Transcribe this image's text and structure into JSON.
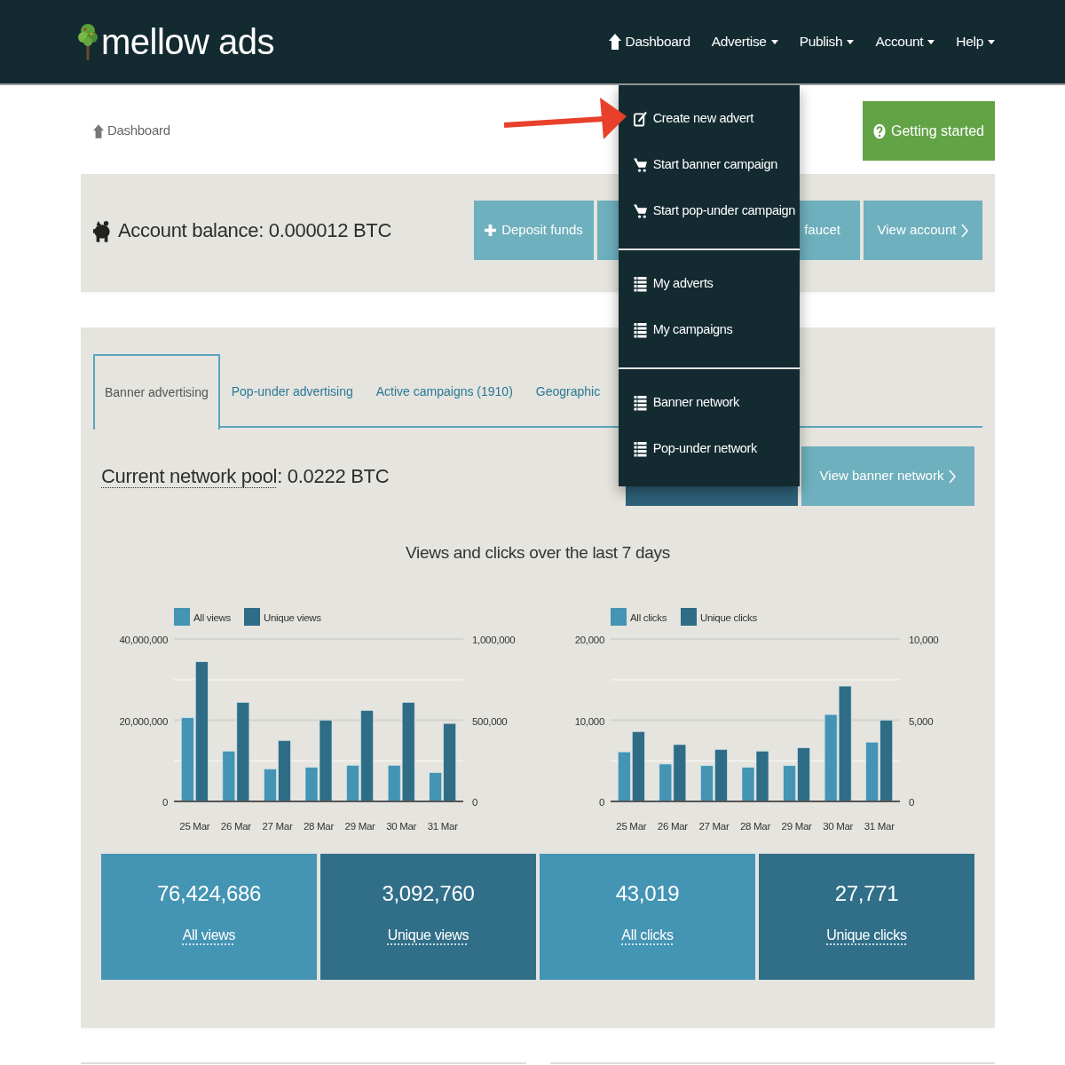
{
  "navbar": {
    "logo": "mellow ads",
    "items": [
      {
        "kind": "home",
        "label": "Dashboard"
      },
      {
        "kind": "dropdown",
        "label": "Advertise",
        "expanded": true,
        "menu": [
          [
            {
              "kind": "create",
              "label": "Create new advert"
            },
            {
              "kind": "cart",
              "label": "Start banner campaign"
            },
            {
              "kind": "cart",
              "label": "Start pop-under campaign"
            }
          ],
          [
            {
              "kind": "list",
              "label": "My adverts"
            },
            {
              "kind": "list",
              "label": "My campaigns"
            }
          ],
          [
            {
              "kind": "list",
              "label": "Banner network"
            },
            {
              "kind": "list",
              "label": "Pop-under network"
            }
          ]
        ]
      },
      {
        "kind": "dropdown",
        "label": "Publish",
        "expanded": false
      },
      {
        "kind": "dropdown",
        "label": "Account",
        "expanded": false
      },
      {
        "kind": "dropdown",
        "label": "Help",
        "expanded": false
      }
    ]
  },
  "breadcrumb": {
    "label": "Dashboard"
  },
  "getting_started_button": {
    "label": "Getting started"
  },
  "balance": {
    "text": "Account balance: 0.000012 BTC",
    "buttons": [
      {
        "kind": "add",
        "label": "Deposit funds"
      },
      {
        "kind": "plain"
      },
      {
        "kind": "plain",
        "label": "faucet"
      },
      {
        "kind": "next",
        "label": "View account"
      }
    ]
  },
  "tabs": [
    {
      "label": "Banner advertising",
      "selected": true
    },
    {
      "label": "Pop-under advertising",
      "selected": false
    },
    {
      "label": "Active campaigns (1910)",
      "selected": false
    },
    {
      "label": "Geographic",
      "selected": false
    }
  ],
  "network_pool": {
    "term": "Current network pool",
    "text": ": 0.0222 BTC",
    "buttons": [
      {
        "kind": "primary"
      },
      {
        "kind": "next",
        "label": "View banner network"
      }
    ]
  },
  "charts": {
    "title": "Views and clicks over the last 7 days",
    "panels": [
      {
        "chart_data": {
          "type": "bar",
          "legend": "top-left",
          "categories": [
            "25 Mar",
            "26 Mar",
            "27 Mar",
            "28 Mar",
            "29 Mar",
            "30 Mar",
            "31 Mar"
          ],
          "series": [
            {
              "name": "All views",
              "color": "#4494b4",
              "values": [
                20600000,
                12400000,
                8000000,
                8400000,
                8900000,
                8900000,
                7100000
              ]
            },
            {
              "name": "Unique views",
              "color": "#2f6d87",
              "axis": "y2",
              "values": [
                860000,
                610000,
                375000,
                500000,
                560000,
                610000,
                480000
              ]
            }
          ],
          "ylim": [
            0,
            40000000
          ],
          "yticks": [
            {
              "value": 0,
              "label": "0"
            },
            {
              "value": 20000000,
              "label": "20,000,000"
            },
            {
              "value": 40000000,
              "label": "40,000,000"
            }
          ],
          "ref_lines": [
            {
              "axis": "y",
              "value": 10000000
            },
            {
              "axis": "y",
              "value": 30000000
            }
          ],
          "y2lim": [
            0,
            1000000
          ],
          "y2ticks": [
            {
              "value": 0,
              "label": "0"
            },
            {
              "value": 500000,
              "label": "500,000"
            },
            {
              "value": 1000000,
              "label": "1,000,000"
            }
          ]
        }
      },
      {
        "chart_data": {
          "type": "bar",
          "legend": "top-left",
          "categories": [
            "25 Mar",
            "26 Mar",
            "27 Mar",
            "28 Mar",
            "29 Mar",
            "30 Mar",
            "31 Mar"
          ],
          "series": [
            {
              "name": "All clicks",
              "color": "#4494b4",
              "values": [
                6100,
                4600,
                4400,
                4200,
                4400,
                10700,
                7300
              ]
            },
            {
              "name": "Unique clicks",
              "color": "#2f6d87",
              "axis": "y2",
              "values": [
                4300,
                3500,
                3200,
                3100,
                3300,
                7100,
                5000
              ]
            }
          ],
          "ylim": [
            0,
            20000
          ],
          "yticks": [
            {
              "value": 0,
              "label": "0"
            },
            {
              "value": 10000,
              "label": "10,000"
            },
            {
              "value": 20000,
              "label": "20,000"
            }
          ],
          "ref_lines": [
            {
              "axis": "y",
              "value": 5000
            },
            {
              "axis": "y",
              "value": 15000
            }
          ],
          "y2lim": [
            0,
            10000
          ],
          "y2ticks": [
            {
              "value": 0,
              "label": "0"
            },
            {
              "value": 5000,
              "label": "5,000"
            },
            {
              "value": 10000,
              "label": "10,000"
            }
          ]
        }
      }
    ]
  },
  "tiles": [
    {
      "value": "76,424,686",
      "label": "All views",
      "color": "#4494b4"
    },
    {
      "value": "3,092,760",
      "label": "Unique views",
      "color": "#316f89"
    },
    {
      "value": "43,019",
      "label": "All clicks",
      "color": "#4494b4"
    },
    {
      "value": "27,771",
      "label": "Unique clicks",
      "color": "#316f89"
    }
  ]
}
